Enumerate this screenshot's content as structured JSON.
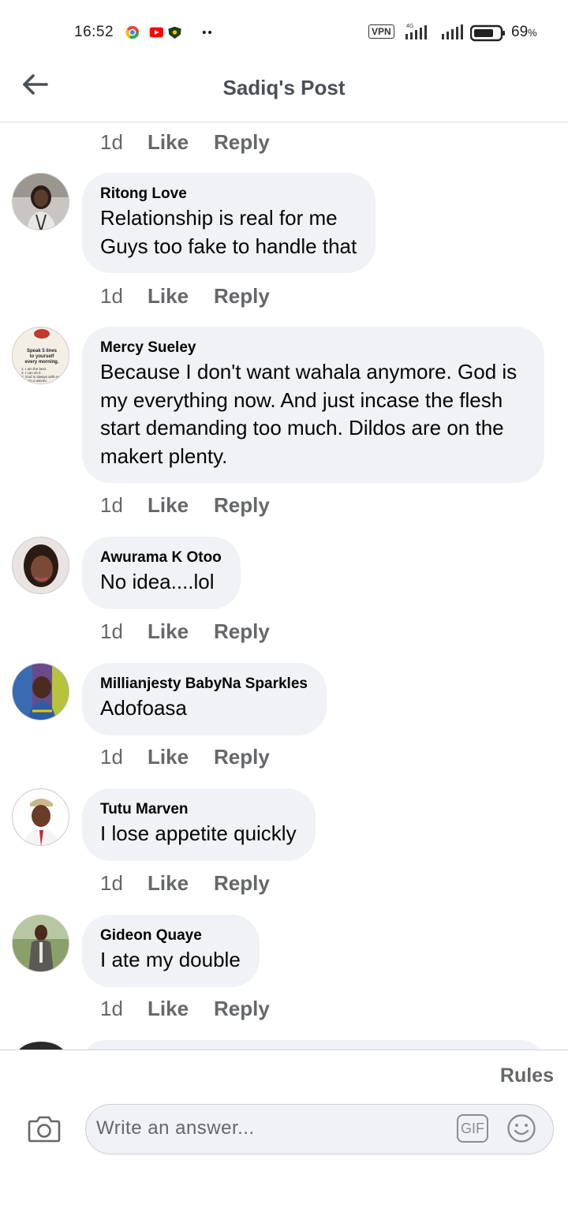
{
  "status_bar": {
    "time": "16:52",
    "vpn": "VPN",
    "network": "4G",
    "battery": "69",
    "battery_unit": "%",
    "icons": [
      "chrome-icon",
      "youtube-icon",
      "shield-app-icon",
      "more-dots-icon",
      "signal-icon",
      "signal-icon-2",
      "battery-icon"
    ]
  },
  "header": {
    "title": "Sadiq's Post",
    "back_icon": "back-arrow-icon"
  },
  "top_actions": {
    "time": "1d",
    "like": "Like",
    "reply": "Reply"
  },
  "comments": [
    {
      "author": "Ritong Love",
      "lines": [
        "Relationship is real for me",
        "Guys too fake to handle that"
      ],
      "time": "1d",
      "like": "Like",
      "reply": "Reply"
    },
    {
      "author": "Mercy Sueley",
      "lines": [
        "Because I don't want wahala anymore. God is",
        "my everything now. And just incase the flesh",
        "start demanding too much. Dildos are on the",
        "makert plenty."
      ],
      "avatar_text": [
        "Speak 5 lines",
        "to yourself",
        "every morning.",
        "1. I am the best.",
        "2. I can do it.",
        "3. God is always with me.",
        "4. I am a winner."
      ],
      "time": "1d",
      "like": "Like",
      "reply": "Reply"
    },
    {
      "author": "Awurama K Otoo",
      "lines": [
        "No idea....lol"
      ],
      "time": "1d",
      "like": "Like",
      "reply": "Reply"
    },
    {
      "author": "Millianjesty BabyNa Sparkles",
      "lines": [
        "Adofoasa"
      ],
      "time": "1d",
      "like": "Like",
      "reply": "Reply"
    },
    {
      "author": "Tutu Marven",
      "lines": [
        "I lose appetite quickly"
      ],
      "time": "1d",
      "like": "Like",
      "reply": "Reply"
    },
    {
      "author": "Gideon Quaye",
      "lines": [
        "I ate my double"
      ],
      "time": "1d",
      "like": "Like",
      "reply": "Reply"
    }
  ],
  "footer": {
    "rules": "Rules",
    "placeholder": "Write an answer...",
    "gif": "GIF",
    "camera_icon": "camera-icon",
    "emoji_icon": "emoji-icon"
  },
  "colors": {
    "bubble": "#f0f2f5",
    "secondary_text": "#65676b",
    "title_text": "#4b4f56"
  }
}
